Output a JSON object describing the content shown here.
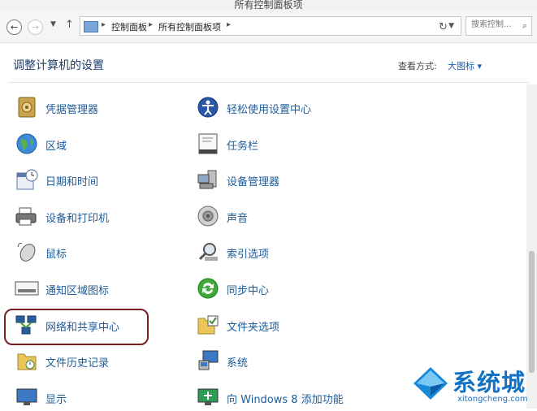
{
  "window": {
    "title": "所有控制面板项"
  },
  "address_bar": {
    "crumbs": [
      "控制面板",
      "所有控制面板项"
    ],
    "search_placeholder": "搜索控制..."
  },
  "header": {
    "title": "调整计算机的设置",
    "view_by_label": "查看方式:",
    "view_by_value": "大图标 ▾"
  },
  "items": [
    {
      "label": "凭据管理器",
      "icon": "credential-vault-icon"
    },
    {
      "label": "轻松使用设置中心",
      "icon": "ease-of-access-icon"
    },
    {
      "label": "区域",
      "icon": "region-globe-icon"
    },
    {
      "label": "任务栏",
      "icon": "taskbar-icon"
    },
    {
      "label": "日期和时间",
      "icon": "calendar-clock-icon"
    },
    {
      "label": "设备管理器",
      "icon": "device-manager-icon"
    },
    {
      "label": "设备和打印机",
      "icon": "printer-icon"
    },
    {
      "label": "声音",
      "icon": "speaker-icon"
    },
    {
      "label": "鼠标",
      "icon": "mouse-icon"
    },
    {
      "label": "索引选项",
      "icon": "indexing-search-icon"
    },
    {
      "label": "通知区域图标",
      "icon": "notification-area-icon"
    },
    {
      "label": "同步中心",
      "icon": "sync-icon"
    },
    {
      "label": "网络和共享中心",
      "icon": "network-icon"
    },
    {
      "label": "文件夹选项",
      "icon": "folder-options-icon"
    },
    {
      "label": "文件历史记录",
      "icon": "file-history-icon"
    },
    {
      "label": "系统",
      "icon": "system-computer-icon"
    },
    {
      "label": "显示",
      "icon": "display-monitor-icon"
    },
    {
      "label": "向 Windows 8 添加功能",
      "icon": "add-features-icon"
    }
  ],
  "watermark": {
    "text": "系统城",
    "url": "xitongcheng.com"
  }
}
